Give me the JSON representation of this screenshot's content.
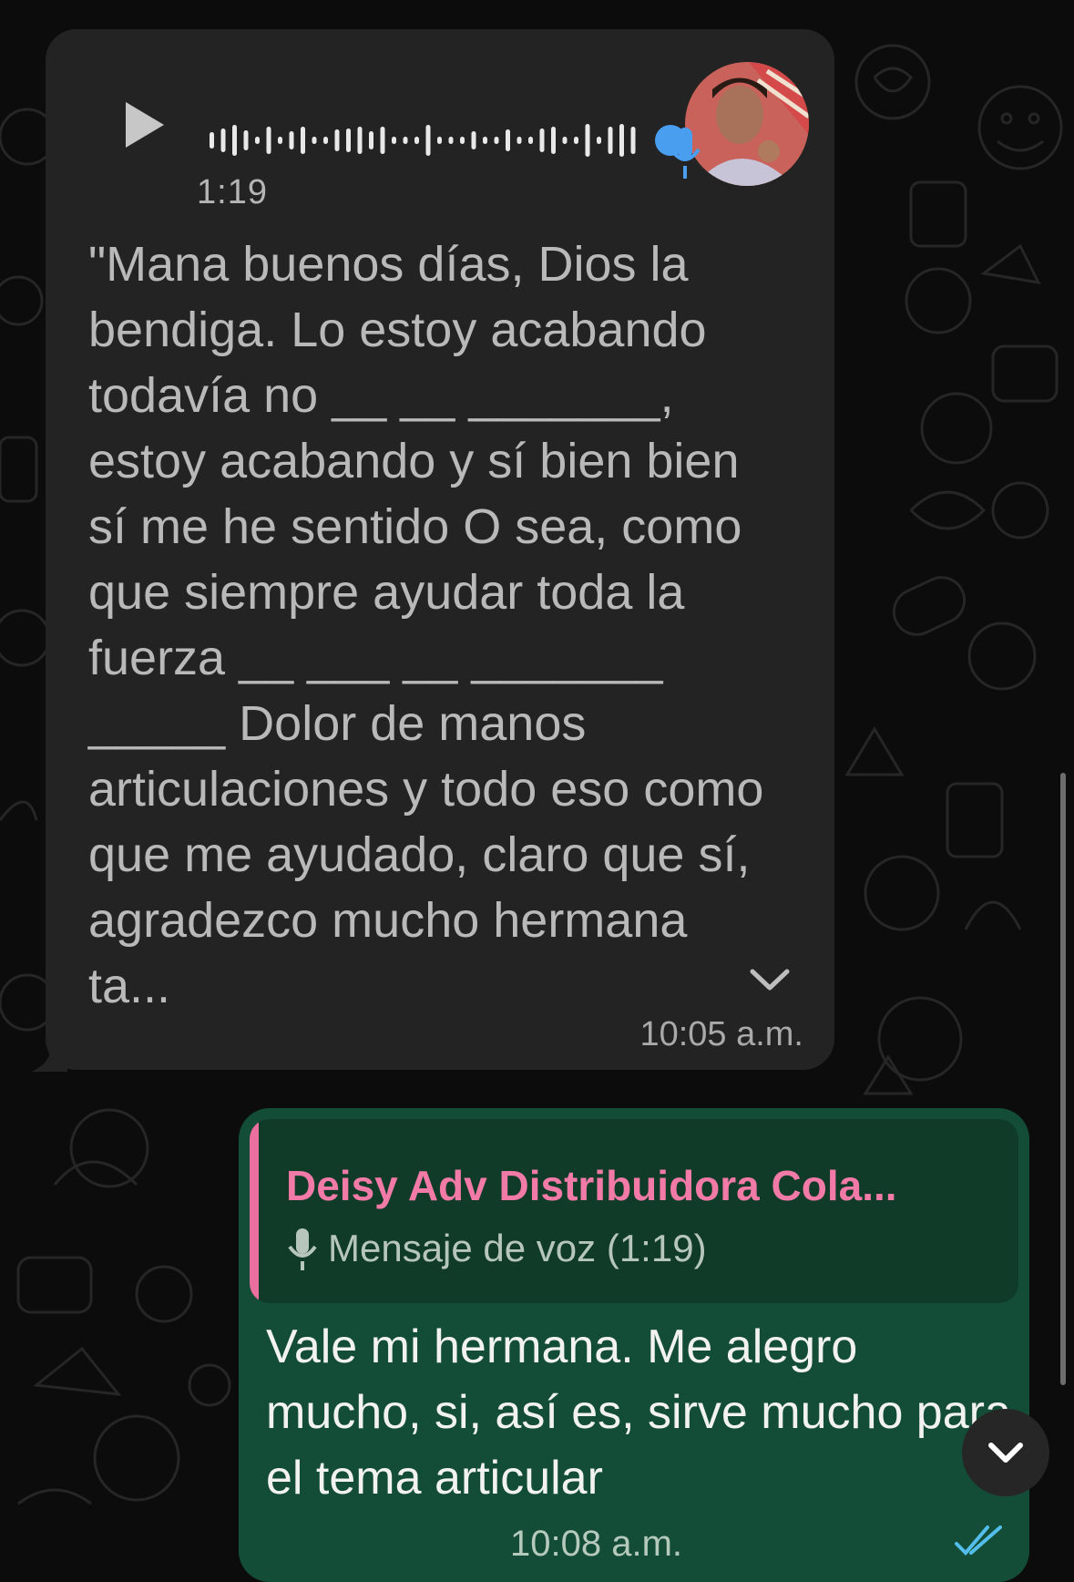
{
  "incoming": {
    "duration": "1:19",
    "transcript": "\"Mana buenos días, Dios la bendiga. Lo estoy acabando todavía no __ __ _______, estoy acabando y sí bien bien sí me he sentido O sea, como que siempre ayudar toda la fuerza __ ___ __ _______ _____ Dolor de manos articulaciones y todo eso como que me ayudado, claro que sí, agradezco mucho hermana ta...",
    "time": "10:05 a.m."
  },
  "outgoing": {
    "quote_author": "Deisy Adv Distribuidora Cola...",
    "quote_text": "Mensaje de voz (1:19)",
    "text": "Vale mi hermana. Me alegro mucho, si, así es, sirve mucho para el tema articular",
    "time": "10:08 a.m."
  },
  "colors": {
    "incoming_bubble": "#232323",
    "outgoing_bubble": "#144d37",
    "quote_accent": "#ea6f9e",
    "read_ticks": "#53bdeb",
    "wave_dot": "#4a9ef0"
  },
  "icons": {
    "play": "play-icon",
    "mic": "microphone-icon",
    "expand": "chevron-down-icon",
    "read": "double-check-icon",
    "scroll": "chevron-down-icon"
  }
}
